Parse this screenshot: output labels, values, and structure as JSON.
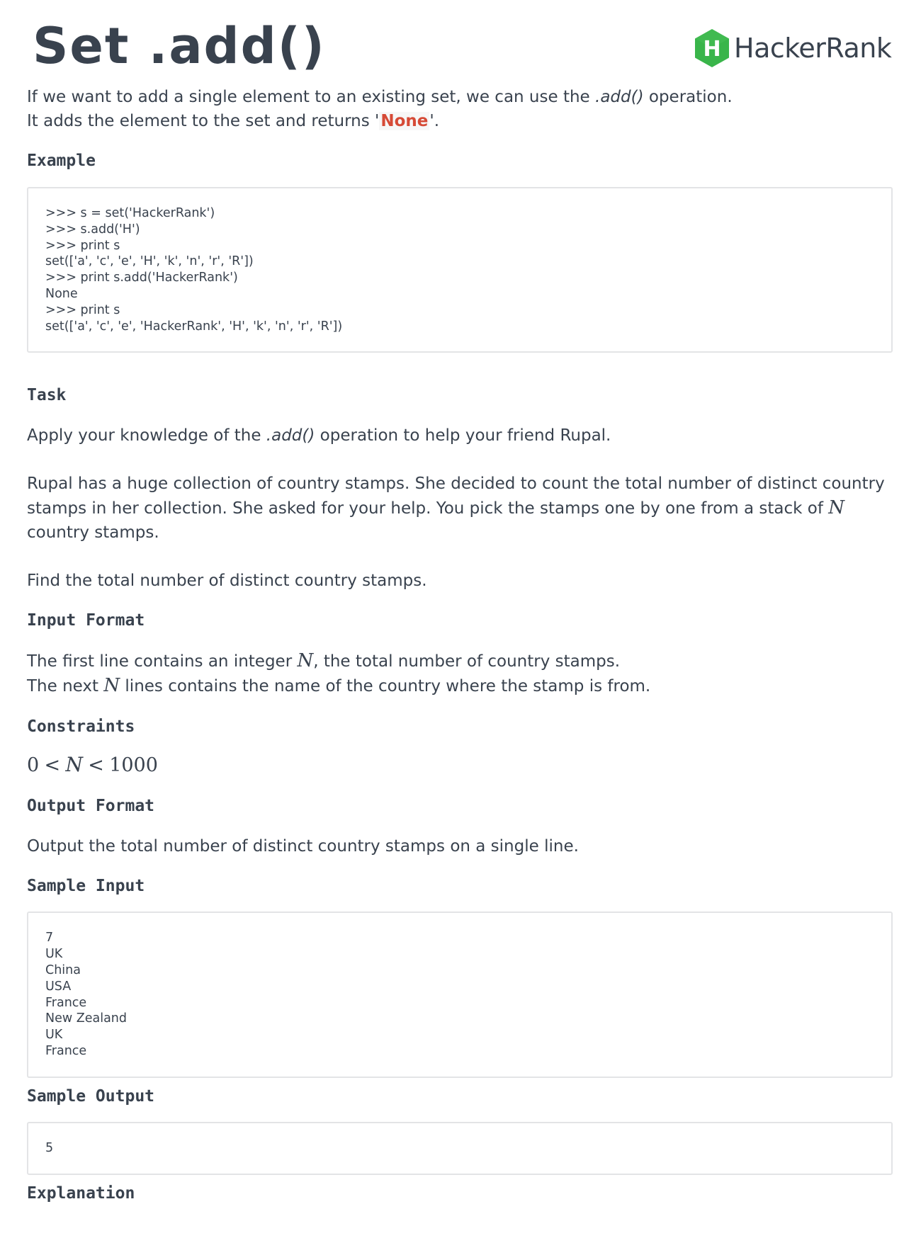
{
  "title": "Set .add()",
  "logo": {
    "letter": "H",
    "text": "HackerRank",
    "color": "#39b54a"
  },
  "intro": {
    "line1_pre": "If we want to add a single element to an existing set, we can use the ",
    "line1_em": ".add()",
    "line1_post": " operation.",
    "line2_pre": "It adds the element to the set and returns '",
    "line2_code": "None",
    "line2_post": "'."
  },
  "example": {
    "heading": "Example",
    "lines": [
      ">>> s = set('HackerRank')",
      ">>> s.add('H')",
      ">>> print s",
      "set(['a', 'c', 'e', 'H', 'k', 'n', 'r', 'R'])",
      ">>> print s.add('HackerRank')",
      "None",
      ">>> print s",
      "set(['a', 'c', 'e', 'HackerRank', 'H', 'k', 'n', 'r', 'R'])"
    ]
  },
  "task": {
    "heading": "Task",
    "p1_pre": "Apply your knowledge of the ",
    "p1_em": ".add()",
    "p1_post": " operation to help your friend Rupal.",
    "p2_pre": "Rupal has a huge collection of country stamps. She decided to count the total number of distinct country stamps in her collection. She asked for your help. You pick the stamps one by one from a stack of ",
    "p2_var": "N",
    "p2_post": " country stamps.",
    "p3": "Find the total number of distinct country stamps."
  },
  "input_format": {
    "heading": "Input Format",
    "l1_pre": "The first line contains an integer ",
    "l1_var": "N",
    "l1_post": ", the total number of country stamps.",
    "l2_pre": "The next ",
    "l2_var": "N",
    "l2_post": " lines contains the name of the country where the stamp is from."
  },
  "constraints": {
    "heading": "Constraints",
    "low": "0",
    "lt1": "<",
    "var": "N",
    "lt2": "<",
    "high": "1000"
  },
  "output_format": {
    "heading": "Output Format",
    "text": "Output the total number of distinct country stamps on a single line."
  },
  "sample_input": {
    "heading": "Sample Input",
    "lines": [
      "7",
      "UK",
      "China",
      "USA",
      "France",
      "New Zealand",
      "UK",
      "France"
    ]
  },
  "sample_output": {
    "heading": "Sample Output",
    "lines": [
      "5"
    ]
  },
  "explanation": {
    "heading": "Explanation"
  }
}
